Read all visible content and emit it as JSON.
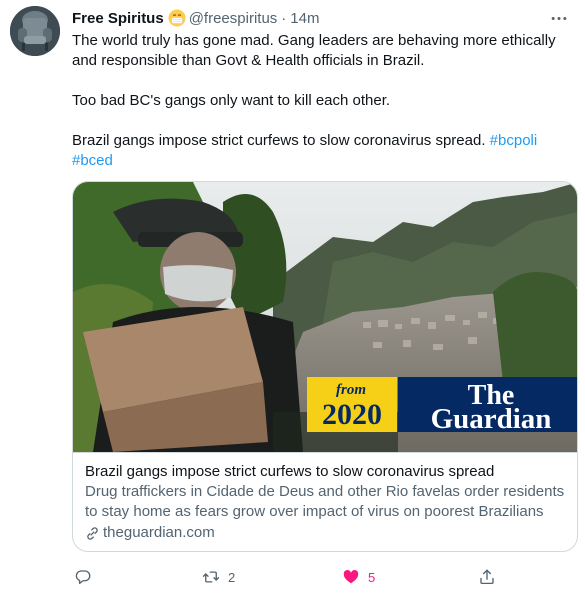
{
  "tweet": {
    "author_name": "Free Spiritus",
    "handle": "@freespiritus",
    "separator": "·",
    "time": "14m",
    "paragraphs": {
      "p1": "The world truly has gone mad. Gang leaders are behaving more ethically and responsible than Govt & Health officials in Brazil.",
      "p2": "Too bad BC's gangs only want to kill each other.",
      "p3_text": "Brazil gangs impose strict curfews to slow coronavirus spread.",
      "hashtag1": "#bcpoli",
      "hashtag2": "#bced"
    }
  },
  "card": {
    "image": {
      "badge_from": "from",
      "badge_year": "2020",
      "brand_line1": "The",
      "brand_line2": "Guardian",
      "badge_yellow": "#f5d016",
      "brand_blue": "#052962"
    },
    "title": "Brazil gangs impose strict curfews to slow coronavirus spread",
    "description": "Drug traffickers in Cidade de Deus and other Rio favelas order residents to stay home as fears grow over impact of virus on poorest Brazilians",
    "domain": "theguardian.com"
  },
  "actions": {
    "reply_count": "",
    "retweet_count": "2",
    "like_count": "5",
    "like_color": "#f91880",
    "icon_color": "#536471"
  }
}
